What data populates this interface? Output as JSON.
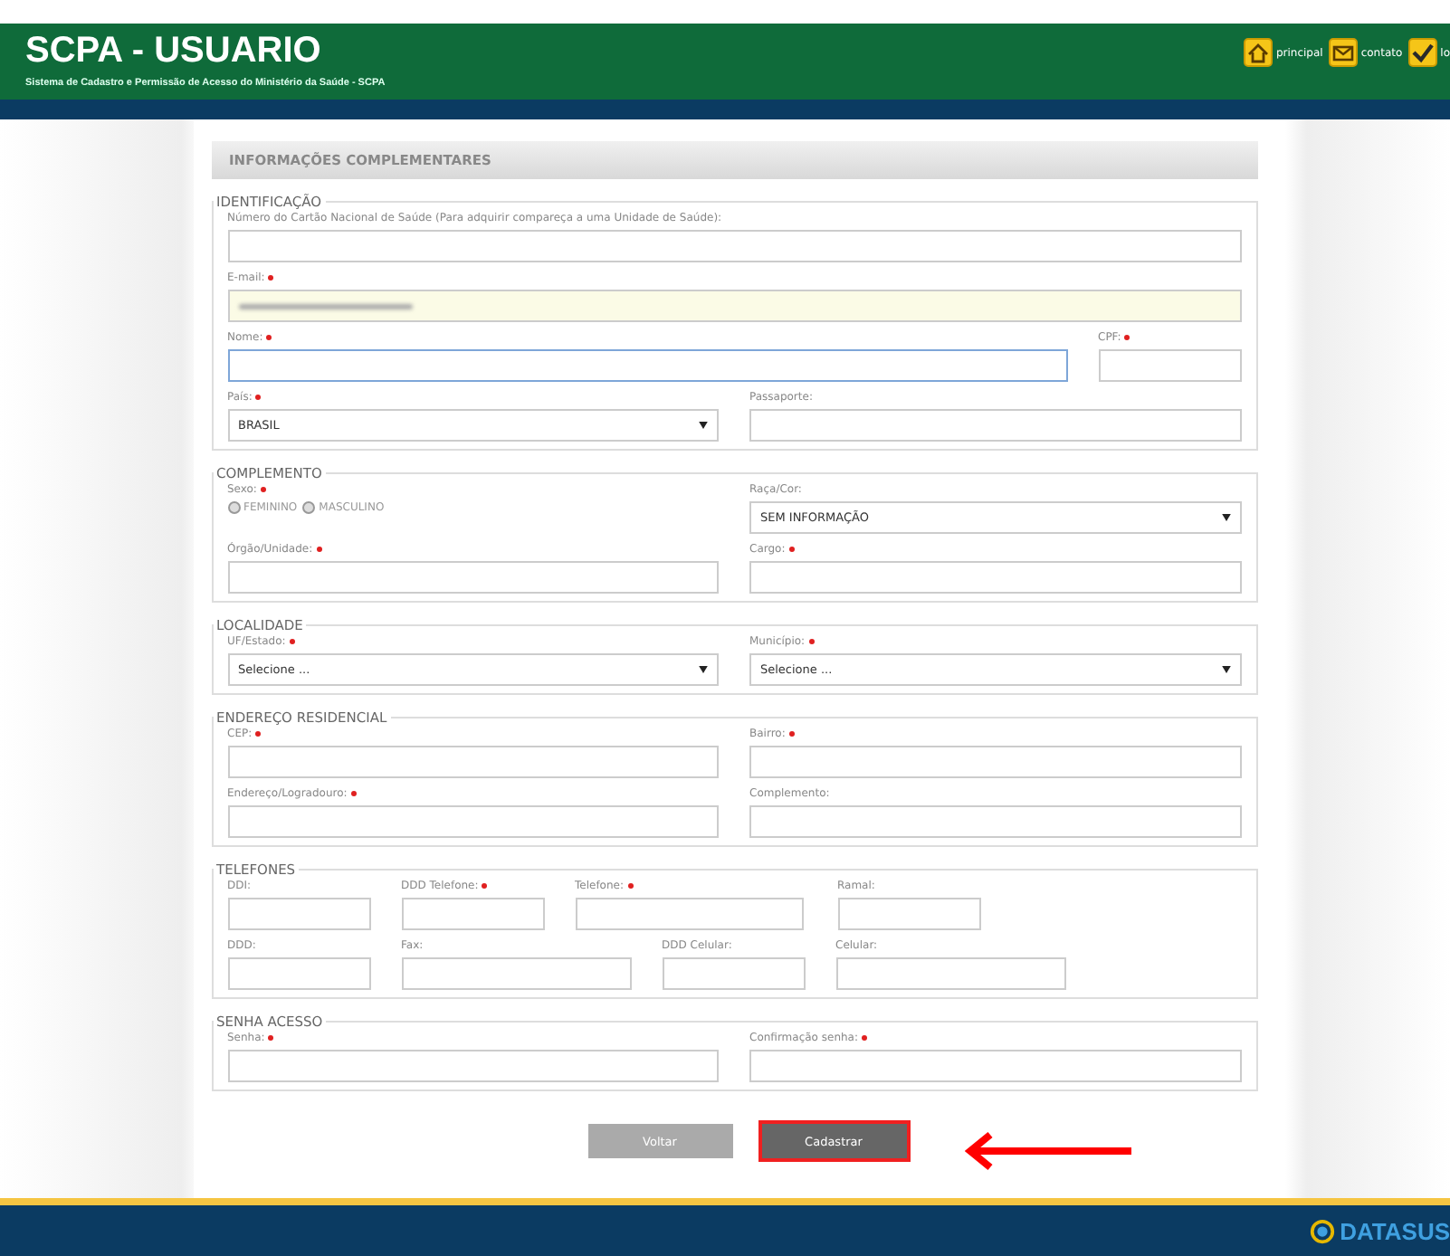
{
  "header": {
    "title": "SCPA - USUARIO",
    "subtitle": "Sistema de Cadastro e Permissão de Acesso do Ministério da Saúde - SCPA",
    "links": [
      {
        "kind": "home",
        "label": "principal"
      },
      {
        "kind": "mail",
        "label": "contato"
      },
      {
        "kind": "check",
        "label": "lo"
      }
    ]
  },
  "form": {
    "title": "INFORMAÇÕES COMPLEMENTARES",
    "sections": [
      {
        "legend": "IDENTIFICAÇÃO",
        "rows": [
          {
            "kind": "full",
            "fields": [
              {
                "kind": "text",
                "label": "Número do Cartão Nacional de Saúde (Para adquirir compareça a uma Unidade de Saúde):",
                "required": false
              }
            ]
          },
          {
            "kind": "full",
            "fields": [
              {
                "kind": "masked",
                "label": "E-mail:",
                "required": true
              }
            ]
          },
          {
            "kind": "wide-narrow",
            "fields": [
              {
                "kind": "text",
                "label": "Nome:",
                "required": true,
                "focused": true
              },
              {
                "kind": "text",
                "label": "CPF:",
                "required": true
              }
            ]
          },
          {
            "kind": "half",
            "fields": [
              {
                "kind": "select",
                "label": "País:",
                "required": true,
                "value": "BRASIL"
              },
              {
                "kind": "text",
                "label": "Passaporte:",
                "required": false
              }
            ]
          }
        ]
      },
      {
        "legend": "COMPLEMENTO",
        "rows": [
          {
            "kind": "half",
            "fields": [
              {
                "kind": "radio",
                "label": "Sexo:",
                "required": true,
                "options": [
                  {
                    "label": "FEMININO",
                    "selected": false
                  },
                  {
                    "label": "MASCULINO",
                    "selected": false
                  }
                ]
              },
              {
                "kind": "select",
                "label": "Raça/Cor:",
                "required": false,
                "value": "SEM INFORMAÇÃO"
              }
            ]
          },
          {
            "kind": "half",
            "fields": [
              {
                "kind": "text",
                "label": "Órgão/Unidade:",
                "required": true
              },
              {
                "kind": "text",
                "label": "Cargo:",
                "required": true
              }
            ]
          }
        ]
      },
      {
        "legend": "LOCALIDADE",
        "rows": [
          {
            "kind": "half",
            "fields": [
              {
                "kind": "select",
                "label": "UF/Estado:",
                "required": true,
                "value": "Selecione ..."
              },
              {
                "kind": "select",
                "label": "Município:",
                "required": true,
                "value": "Selecione ..."
              }
            ]
          }
        ]
      },
      {
        "legend": "ENDEREÇO RESIDENCIAL",
        "rows": [
          {
            "kind": "half",
            "fields": [
              {
                "kind": "text",
                "label": "CEP:",
                "required": true
              },
              {
                "kind": "text",
                "label": "Bairro:",
                "required": true
              }
            ]
          },
          {
            "kind": "half",
            "fields": [
              {
                "kind": "text",
                "label": "Endereço/Logradouro:",
                "required": true
              },
              {
                "kind": "text",
                "label": "Complemento:",
                "required": false
              }
            ]
          }
        ]
      },
      {
        "legend": "TELEFONES",
        "rows": [
          {
            "kind": "tel1",
            "fields": [
              {
                "kind": "text",
                "label": "DDI:",
                "required": false
              },
              {
                "kind": "text",
                "label": "DDD Telefone:",
                "required": true
              },
              {
                "kind": "text",
                "label": "Telefone:",
                "required": true
              },
              {
                "kind": "text",
                "label": "Ramal:",
                "required": false
              }
            ]
          },
          {
            "kind": "tel2",
            "fields": [
              {
                "kind": "text",
                "label": "DDD:",
                "required": false
              },
              {
                "kind": "text",
                "label": "Fax:",
                "required": false
              },
              {
                "kind": "text",
                "label": "DDD Celular:",
                "required": false
              },
              {
                "kind": "text",
                "label": "Celular:",
                "required": false
              }
            ]
          }
        ]
      },
      {
        "legend": "SENHA ACESSO",
        "rows": [
          {
            "kind": "half",
            "fields": [
              {
                "kind": "password",
                "label": "Senha:",
                "required": true
              },
              {
                "kind": "password",
                "label": "Confirmação senha:",
                "required": true
              }
            ]
          }
        ]
      }
    ],
    "buttons": [
      {
        "kind": "secondary",
        "label": "Voltar",
        "highlighted": false
      },
      {
        "kind": "primary",
        "label": "Cadastrar",
        "highlighted": true
      }
    ]
  },
  "footer": {
    "logo": "DATASUS"
  }
}
